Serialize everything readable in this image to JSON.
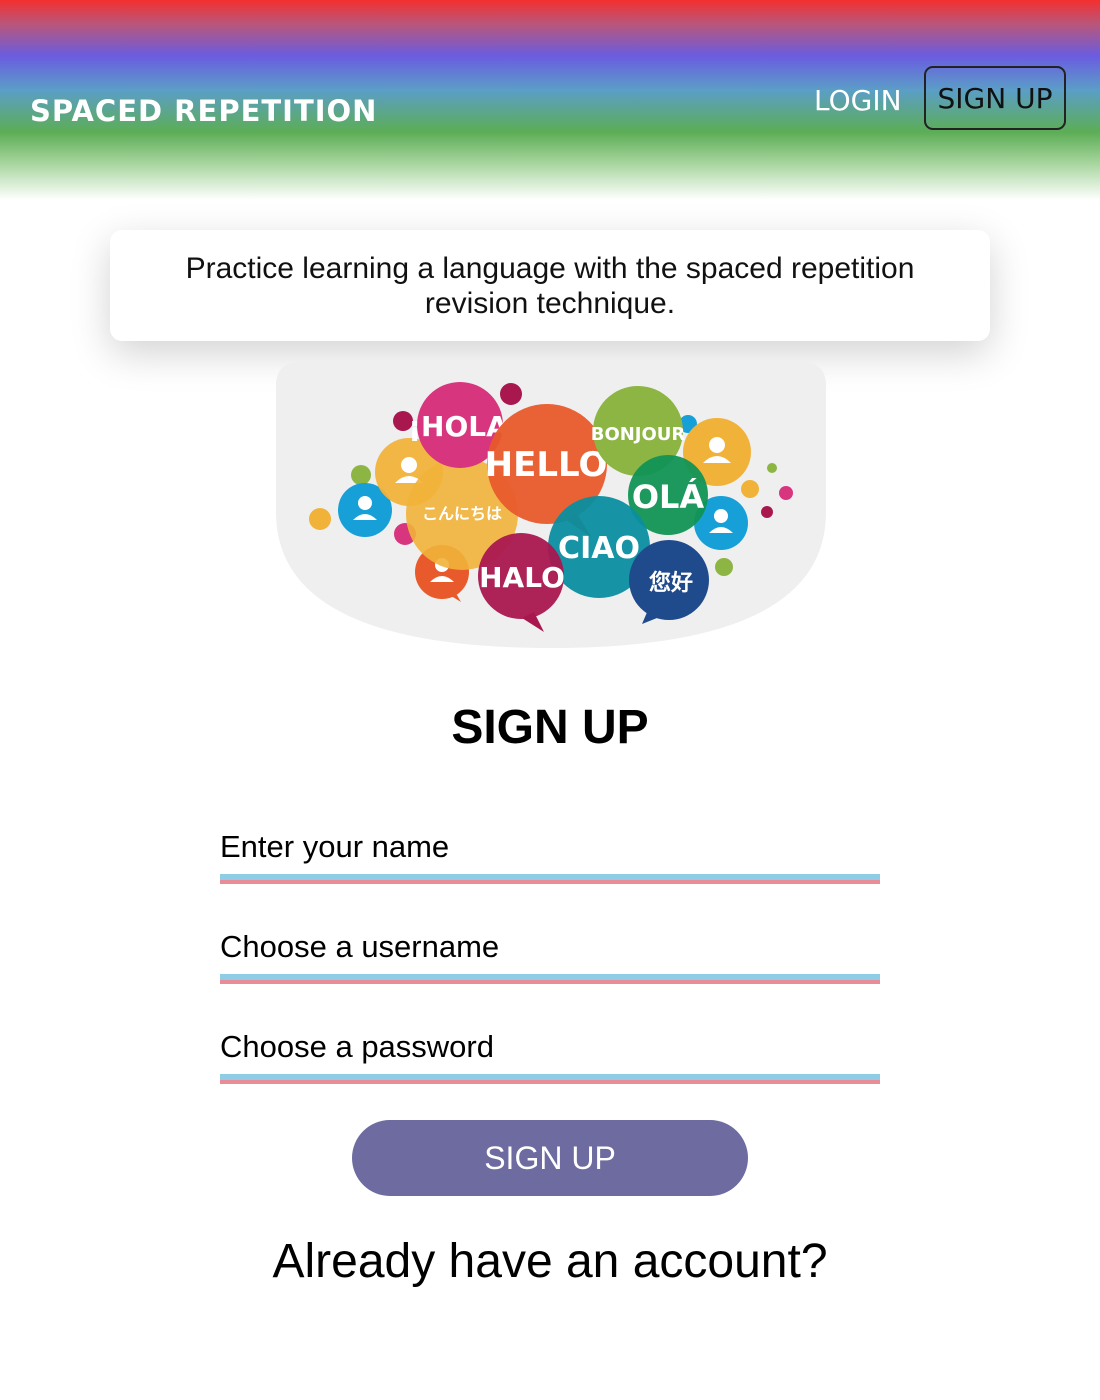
{
  "header": {
    "brand": "SPACED REPETITION",
    "login_label": "LOGIN",
    "signup_label": "SIGN UP"
  },
  "tagline": "Practice learning a language with the spaced repetition revision technique.",
  "hero": {
    "bubbles": [
      "¡HOLA",
      "HELLO",
      "BONJOUR",
      "OLÁ",
      "こんにちは",
      "CIAO",
      "HALO",
      "您好"
    ],
    "colors": {
      "background": "#efefef",
      "magenta": "#d8357f",
      "orange": "#e85a2b",
      "green": "#8cb543",
      "darkgreen": "#119455",
      "yellow": "#f1b23a",
      "teal": "#0a8ea0",
      "crimson": "#a9174f",
      "navy": "#1f4a8c",
      "blue": "#179fd8"
    }
  },
  "form": {
    "title": "SIGN UP",
    "name_placeholder": "Enter your name",
    "username_placeholder": "Choose a username",
    "password_placeholder": "Choose a password",
    "submit_label": "SIGN UP",
    "already_text": "Already have an account?"
  },
  "colors": {
    "button": "#6d6b9f",
    "underline_top": "#8fcde6",
    "underline_bottom": "#e88c98"
  }
}
